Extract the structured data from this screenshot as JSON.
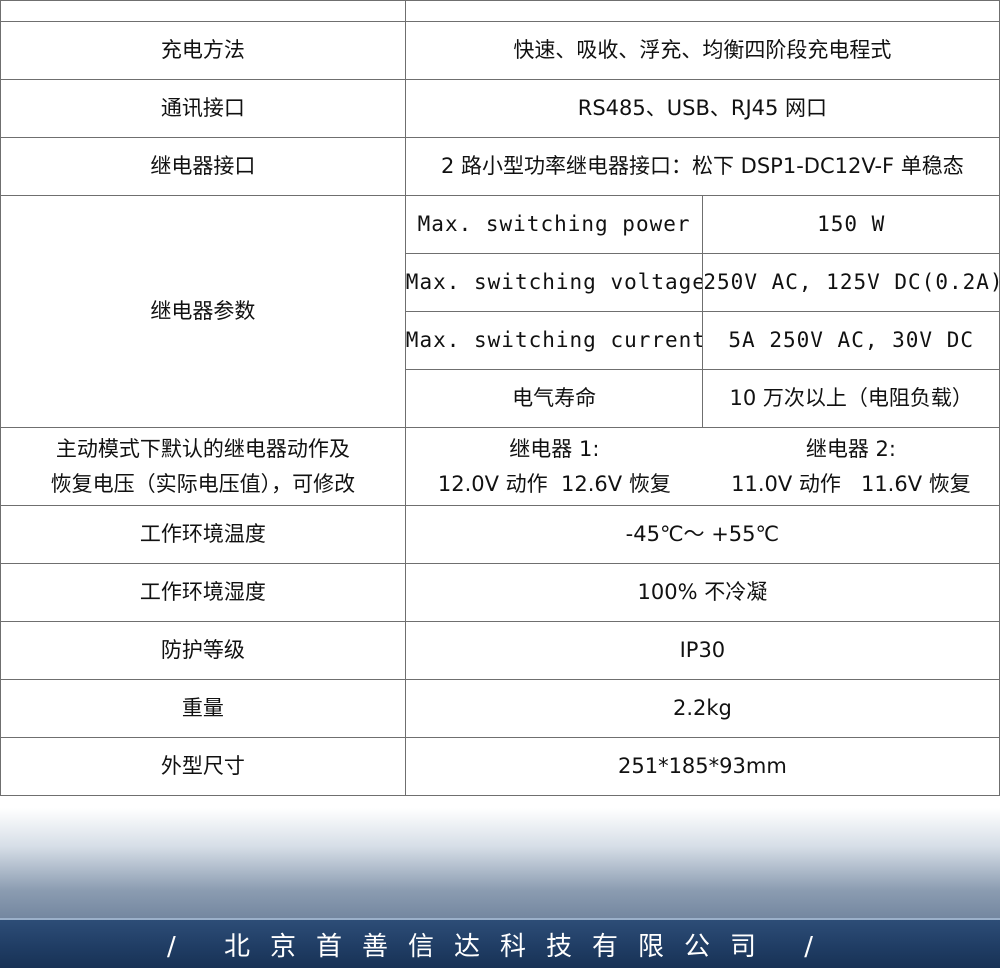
{
  "spec_rows": {
    "top_cutoff": {
      "label": "",
      "value": ""
    },
    "charging_method": {
      "label": "充电方法",
      "value": "快速、吸收、浮充、均衡四阶段充电程式"
    },
    "comm_interface": {
      "label": "通讯接口",
      "value": "RS485、USB、RJ45 网口"
    },
    "relay_interface": {
      "label": "继电器接口",
      "value": "2 路小型功率继电器接口：松下 DSP1-DC12V-F 单稳态"
    },
    "relay_params": {
      "label": "继电器参数",
      "items": [
        {
          "name": "Max. switching power",
          "value": "150 W"
        },
        {
          "name": "Max. switching voltage",
          "value": "250V AC, 125V DC(0.2A)"
        },
        {
          "name": "Max. switching current",
          "value": "5A  250V AC, 30V DC"
        },
        {
          "name": "电气寿命",
          "value": "10 万次以上（电阻负载）"
        }
      ]
    },
    "relay_default": {
      "label_line1": "主动模式下默认的继电器动作及",
      "label_line2": "恢复电压（实际电压值），可修改",
      "relay1_title": "继电器 1:",
      "relay1_action": "12.0V 动作",
      "relay1_recover": "12.6V 恢复",
      "relay2_title": "继电器 2:",
      "relay2_action": "11.0V 动作",
      "relay2_recover": "11.6V 恢复"
    },
    "operating_temp": {
      "label": "工作环境温度",
      "value": "-45℃～ +55℃"
    },
    "operating_humidity": {
      "label": "工作环境湿度",
      "value": "100% 不冷凝"
    },
    "protection": {
      "label": "防护等级",
      "value": "IP30"
    },
    "weight": {
      "label": "重量",
      "value": "2.2kg"
    },
    "dimensions": {
      "label": "外型尺寸",
      "value": "251*185*93mm"
    }
  },
  "footer": {
    "company": "/ 北京首善信达科技有限公司 /"
  },
  "colors": {
    "footer_bg": "#1f3c63",
    "table_border": "#6f6f6f"
  }
}
